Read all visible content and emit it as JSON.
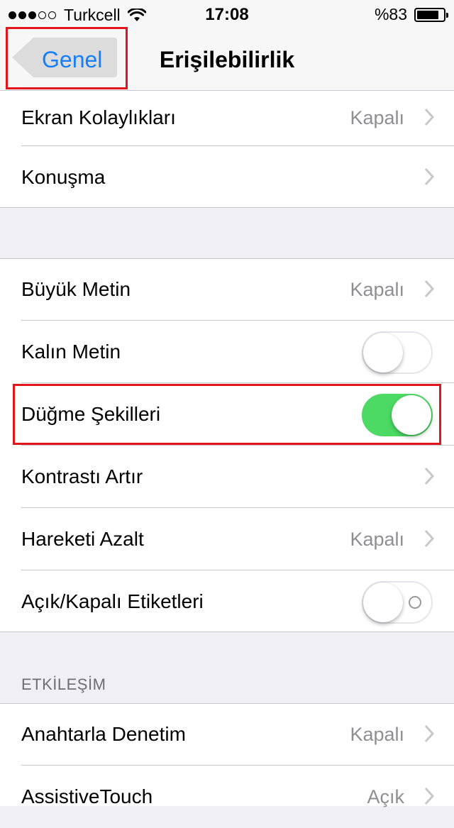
{
  "status_bar": {
    "carrier": "Turkcell",
    "signal_dots_filled": 3,
    "signal_dots_total": 5,
    "time": "17:08",
    "battery_percent": "%83",
    "battery_level": 0.83
  },
  "nav": {
    "back_label": "Genel",
    "title": "Erişilebilirlik"
  },
  "group1": [
    {
      "label": "Ekran Kolaylıkları",
      "value": "Kapalı"
    },
    {
      "label": "Konuşma",
      "value": ""
    }
  ],
  "group2": {
    "buyuk_metin": {
      "label": "Büyük Metin",
      "value": "Kapalı"
    },
    "kalin_metin": {
      "label": "Kalın Metin",
      "state": "off"
    },
    "dugme_sekilleri": {
      "label": "Düğme Şekilleri",
      "state": "on"
    },
    "kontrast": {
      "label": "Kontrastı Artır",
      "value": ""
    },
    "hareket": {
      "label": "Hareketi Azalt",
      "value": "Kapalı"
    },
    "etiketler": {
      "label": "Açık/Kapalı Etiketleri",
      "state": "off"
    }
  },
  "interaction": {
    "header": "ETKİLEŞİM",
    "items": [
      {
        "label": "Anahtarla Denetim",
        "value": "Kapalı"
      },
      {
        "label": "AssistiveTouch",
        "value": "Açık"
      }
    ]
  },
  "colors": {
    "accent": "#147efb",
    "switch_on": "#4cd964",
    "highlight": "#e0161c"
  }
}
